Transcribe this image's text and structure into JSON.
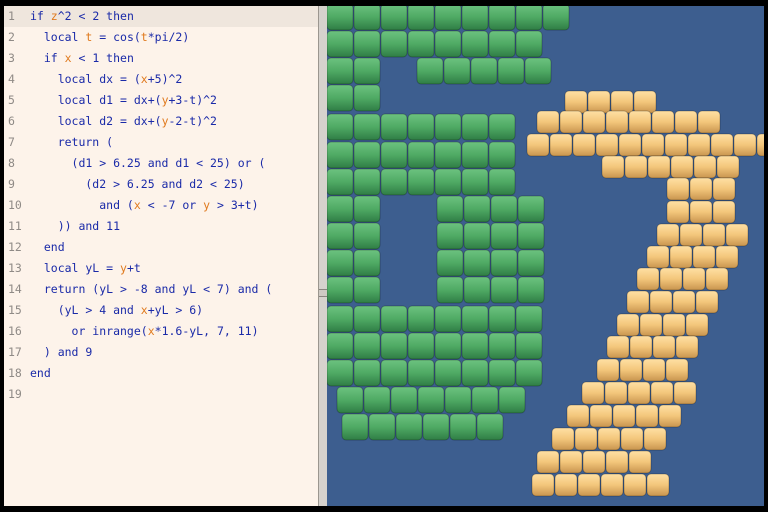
{
  "editor": {
    "lines": [
      {
        "n": "1",
        "tokens": [
          [
            "kw",
            "if "
          ],
          [
            "var",
            "z"
          ],
          [
            "kw",
            "^2 < 2 then"
          ]
        ]
      },
      {
        "n": "2",
        "tokens": [
          [
            "kw",
            "  local "
          ],
          [
            "var",
            "t"
          ],
          [
            "kw",
            " = cos("
          ],
          [
            "var",
            "t"
          ],
          [
            "kw",
            "*pi/2)"
          ]
        ]
      },
      {
        "n": "3",
        "tokens": [
          [
            "kw",
            "  if "
          ],
          [
            "var",
            "x"
          ],
          [
            "kw",
            " < 1 then"
          ]
        ]
      },
      {
        "n": "4",
        "tokens": [
          [
            "kw",
            "    local dx = ("
          ],
          [
            "var",
            "x"
          ],
          [
            "kw",
            "+5)^2"
          ]
        ]
      },
      {
        "n": "5",
        "tokens": [
          [
            "kw",
            "    local d1 = dx+("
          ],
          [
            "var",
            "y"
          ],
          [
            "kw",
            "+3-t)^2"
          ]
        ]
      },
      {
        "n": "6",
        "tokens": [
          [
            "kw",
            "    local d2 = dx+("
          ],
          [
            "var",
            "y"
          ],
          [
            "kw",
            "-2-t)^2"
          ]
        ]
      },
      {
        "n": "7",
        "tokens": [
          [
            "kw",
            "    return ("
          ]
        ]
      },
      {
        "n": "8",
        "tokens": [
          [
            "kw",
            "      (d1 > 6.25 and d1 < 25) or ("
          ]
        ]
      },
      {
        "n": "9",
        "tokens": [
          [
            "kw",
            "        (d2 > 6.25 and d2 < 25)"
          ]
        ]
      },
      {
        "n": "10",
        "tokens": [
          [
            "kw",
            "          and ("
          ],
          [
            "var",
            "x"
          ],
          [
            "kw",
            " < -7 or "
          ],
          [
            "var",
            "y"
          ],
          [
            "kw",
            " > 3+t)"
          ]
        ]
      },
      {
        "n": "11",
        "tokens": [
          [
            "kw",
            "    )) and 11"
          ]
        ]
      },
      {
        "n": "12",
        "tokens": [
          [
            "kw",
            "  end"
          ]
        ]
      },
      {
        "n": "13",
        "tokens": [
          [
            "kw",
            "  local yL = "
          ],
          [
            "var",
            "y"
          ],
          [
            "kw",
            "+t"
          ]
        ]
      },
      {
        "n": "14",
        "tokens": [
          [
            "kw",
            "  return (yL > -8 and yL < 7) and ("
          ]
        ]
      },
      {
        "n": "15",
        "tokens": [
          [
            "kw",
            "    (yL > 4 and "
          ],
          [
            "var",
            "x"
          ],
          [
            "kw",
            "+yL > 6)"
          ]
        ]
      },
      {
        "n": "16",
        "tokens": [
          [
            "kw",
            "      or inrange("
          ],
          [
            "var",
            "x"
          ],
          [
            "kw",
            "*1.6-yL, 7, 11)"
          ]
        ]
      },
      {
        "n": "17",
        "tokens": [
          [
            "kw",
            "  ) and 9"
          ]
        ]
      },
      {
        "n": "18",
        "tokens": [
          [
            "kw",
            "end"
          ]
        ]
      },
      {
        "n": "19",
        "tokens": []
      }
    ]
  },
  "colors": {
    "keyword": "#1a2aa8",
    "variable": "#e07a1e",
    "sky": "#3d5e8f",
    "green_voxel": "#4faa64",
    "yellow_voxel": "#f3c67b"
  }
}
